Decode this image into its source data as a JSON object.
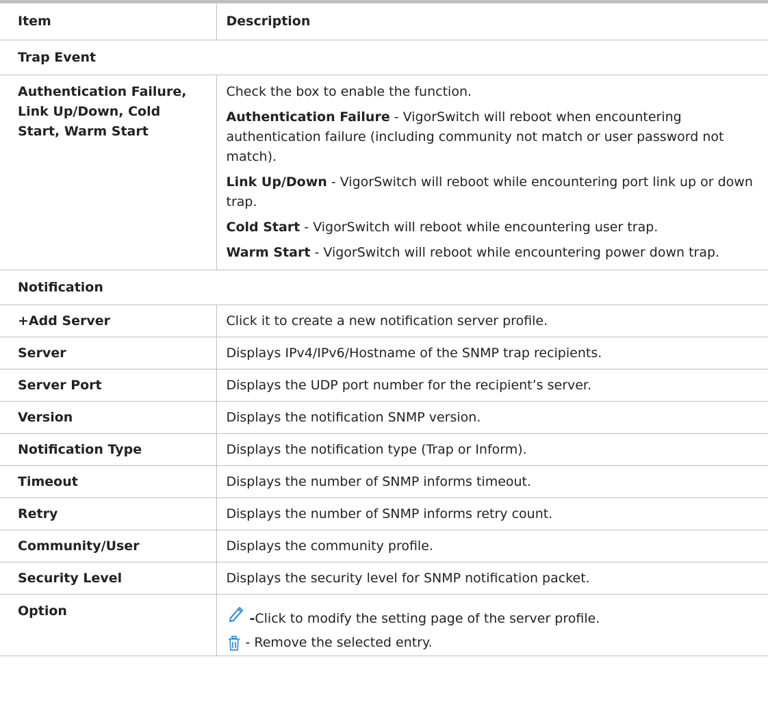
{
  "table": {
    "header": {
      "item": "Item",
      "description": "Description"
    },
    "section_trap": "Trap Event",
    "trap_row": {
      "item": "Authentication Failure, Link Up/Down, Cold Start, Warm Start",
      "intro": "Check the box to enable the function.",
      "entries": [
        {
          "term": "Authentication Failure",
          "text": " - VigorSwitch will reboot when encountering authentication failure (including community not match or user password not match)."
        },
        {
          "term": "Link Up/Down",
          "text": " - VigorSwitch will reboot while encountering port link up or down trap."
        },
        {
          "term": "Cold Start",
          "text": " - VigorSwitch will reboot while encountering user trap."
        },
        {
          "term": "Warm Start",
          "text": " - VigorSwitch will reboot while encountering power down trap."
        }
      ]
    },
    "section_notification": "Notification",
    "rows": [
      {
        "item": "+Add Server",
        "description": "Click it to create a new notification server profile."
      },
      {
        "item": "Server",
        "description": "Displays IPv4/IPv6/Hostname of the SNMP trap recipients."
      },
      {
        "item": "Server Port",
        "description": "Displays the UDP port number for the recipient’s server."
      },
      {
        "item": "Version",
        "description": "Displays the notification SNMP version."
      },
      {
        "item": "Notification Type",
        "description": "Displays the notification type (Trap or Inform)."
      },
      {
        "item": "Timeout",
        "description": "Displays the number of SNMP informs timeout."
      },
      {
        "item": "Retry",
        "description": "Displays the number of SNMP informs retry count."
      },
      {
        "item": "Community/User",
        "description": "Displays the community profile."
      },
      {
        "item": "Security Level",
        "description": "Displays the security level for SNMP notification packet."
      }
    ],
    "option_row": {
      "item": "Option",
      "edit_dash": "-",
      "edit_text": " Click to modify the setting page of the server profile.",
      "remove_text": " - Remove the selected entry."
    }
  },
  "icons": {
    "edit": "pencil-icon",
    "remove": "trash-icon"
  },
  "colors": {
    "icon_blue": "#3a8fd9",
    "border": "#bfbfbf",
    "text": "#222222"
  }
}
